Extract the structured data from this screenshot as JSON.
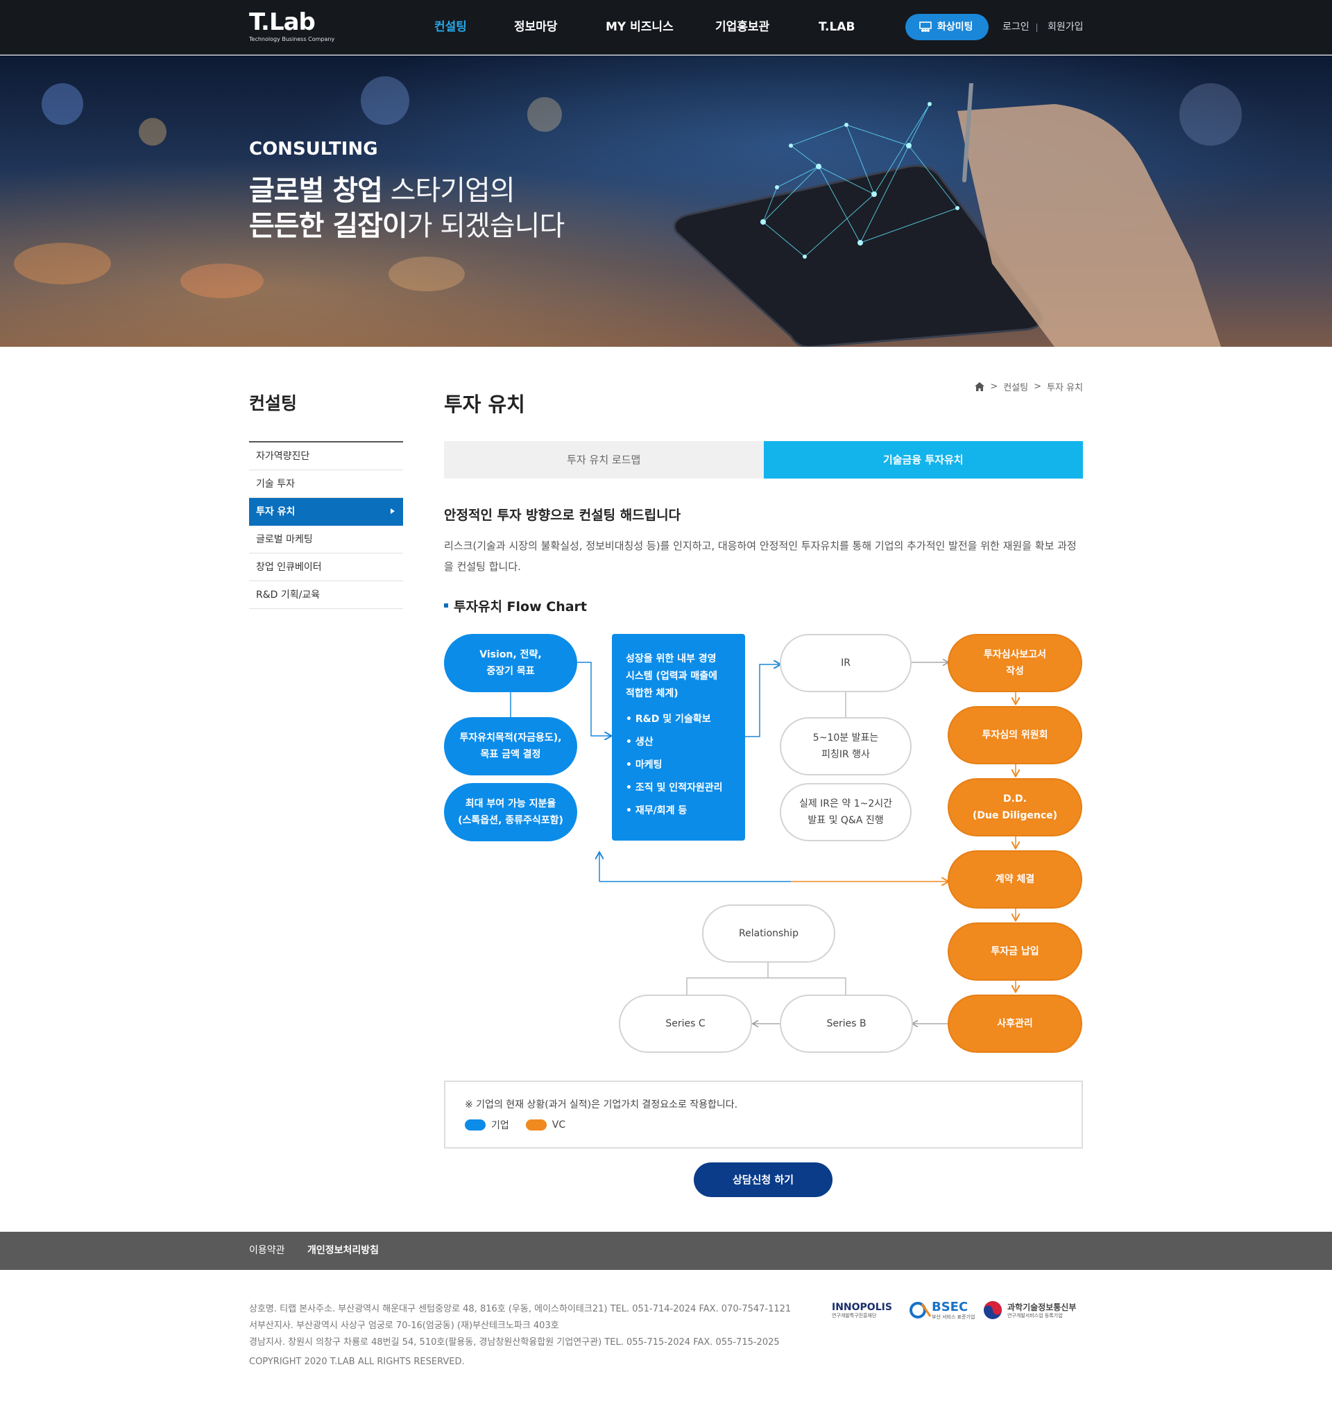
{
  "header": {
    "logo_main": "T.Lab",
    "logo_sub": "Technology Business Company",
    "nav": [
      "컨설팅",
      "정보마당",
      "MY 비즈니스",
      "기업홍보관",
      "T.LAB"
    ],
    "meeting_button": "화상미팅",
    "login": "로그인",
    "signup": "회원가입"
  },
  "hero": {
    "label": "CONSULTING",
    "line1_bold": "글로벌 창업",
    "line1_light": " 스타기업의",
    "line2_bold": "든든한 길잡이",
    "line2_light": "가 되겠습니다"
  },
  "sidebar": {
    "title": "컨설팅",
    "items": [
      "자가역량진단",
      "기술 투자",
      "투자 유치",
      "글로벌 마케팅",
      "창업 인큐베이터",
      "R&D 기획/교육"
    ],
    "active_index": 2
  },
  "content": {
    "title": "투자 유치",
    "breadcrumb": [
      "컨설팅",
      "투자 유치"
    ],
    "breadcrumb_sep": ">",
    "tabs": [
      "투자 유치 로드맵",
      "기술금융 투자유치"
    ],
    "active_tab": 1,
    "lead": "안정적인 투자 방향으로 컨설팅 해드립니다",
    "description": "리스크(기술과 시장의 불확실성, 정보비대칭성 등)를 인지하고, 대응하여 안정적인 투자유치를 통해 기업의 추가적인 발전을 위한 재원을 확보 과정을 컨설팅 합니다.",
    "flow_title": "투자유치 Flow Chart"
  },
  "flowchart": {
    "vision": [
      "Vision, 전략,",
      "중장기 목표"
    ],
    "purpose": [
      "투자유치목적(자금용도),",
      "목표 금액 결정"
    ],
    "share": [
      "최대 부여 가능 지분율",
      "(스톡옵션, 종류주식포함)"
    ],
    "system_title": [
      "성장을 위한 내부 경영",
      "시스템 (업력과 매출에",
      "적합한 체계)"
    ],
    "system_bullets": [
      "• R&D 및 기술확보",
      "• 생산",
      "• 마케팅",
      "• 조직 및 인적자원관리",
      "• 재무/회계 등"
    ],
    "ir": "IR",
    "pitching": [
      "5~10분 발표는",
      "피칭IR 행사"
    ],
    "real_ir": [
      "실제 IR은 약 1~2시간",
      "발표 및 Q&A 진행"
    ],
    "report": [
      "투자심사보고서",
      "작성"
    ],
    "committee": "투자심의 위원회",
    "dd": [
      "D.D.",
      "(Due Diligence)"
    ],
    "contract": "계약 체결",
    "payment": "투자금 납입",
    "after": "사후관리",
    "relationship": "Relationship",
    "series_c": "Series C",
    "series_b": "Series B",
    "colors": {
      "company": "#0c8ce9",
      "vc": "#f0891e"
    }
  },
  "legend": {
    "note": "※ 기업의 현재 상황(과거 실적)은 기업가치 결정요소로 작용합니다.",
    "company": "기업",
    "vc": "VC"
  },
  "apply_button": "상담신청 하기",
  "footer": {
    "links": [
      "이용약관",
      "개인정보처리방침"
    ],
    "info1": "상호명. 티랩   본사주소. 부산광역시 해운대구 센텀중앙로 48, 816호 (우동, 에이스하이테크21)   TEL. 051-714-2024   FAX. 070-7547-1121",
    "info2": "서부산지사. 부산광역시 사상구 엄궁로 70-16(엄궁동) (재)부산테크노파크 403호",
    "info3": "경남지사. 창원시 의창구 차룡로 48번길 54, 510호(팔용동, 경남창원산학융합원 기업연구관)   TEL. 055-715-2024   FAX. 055-715-2025",
    "copyright": "COPYRIGHT 2020 T.LAB ALL RIGHTS RESERVED.",
    "partners": {
      "innopolis": "INNOPOLIS",
      "innopolis_sub": "연구개발특구진흥재단",
      "bsec": "BSEC",
      "bsec_sub": "부산 서비스 표준기업",
      "msit": "과학기술정보통신부",
      "msit_sub": "연구개발서비스업 등록기업"
    }
  }
}
